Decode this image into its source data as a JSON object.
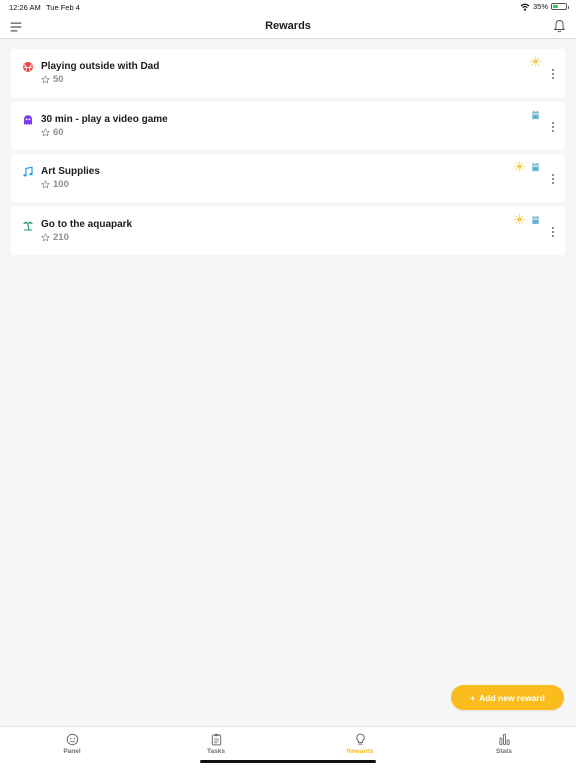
{
  "status_bar": {
    "time": "12:26 AM",
    "date": "Tue Feb 4",
    "battery": "35%",
    "battery_level": 0.35
  },
  "nav": {
    "title": "Rewards",
    "menu_icon": "hamburger-menu-icon",
    "bell_icon": "bell-icon"
  },
  "rewards": [
    {
      "name": "Playing outside with Dad",
      "cost": "50",
      "icon": "ball-icon",
      "icon_color": "#ef4444",
      "avatars": [
        "sun-avatar"
      ]
    },
    {
      "name": "30 min - play a video game",
      "cost": "60",
      "icon": "ghost-icon",
      "icon_color": "#7c3aed",
      "avatars": [
        "owl-avatar"
      ]
    },
    {
      "name": "Art Supplies",
      "cost": "100",
      "icon": "music-note-icon",
      "icon_color": "#1d9bf0",
      "avatars": [
        "sun-avatar",
        "owl-avatar"
      ]
    },
    {
      "name": "Go to the aquapark",
      "cost": "210",
      "icon": "palm-tree-icon",
      "icon_color": "#22a06b",
      "avatars": [
        "sun-avatar",
        "owl-avatar"
      ]
    }
  ],
  "fab": {
    "label": "Add new reward",
    "plus": "+"
  },
  "tabs": [
    {
      "label": "Panel",
      "icon": "smiley-icon"
    },
    {
      "label": "Tasks",
      "icon": "clipboard-icon"
    },
    {
      "label": "Rewards",
      "icon": "lightbulb-icon",
      "active": true
    },
    {
      "label": "Stats",
      "icon": "bar-chart-icon"
    }
  ],
  "colors": {
    "accent": "#fbbd1d",
    "background": "#f6f6f8",
    "inactive_tab": "#6e6e73"
  }
}
